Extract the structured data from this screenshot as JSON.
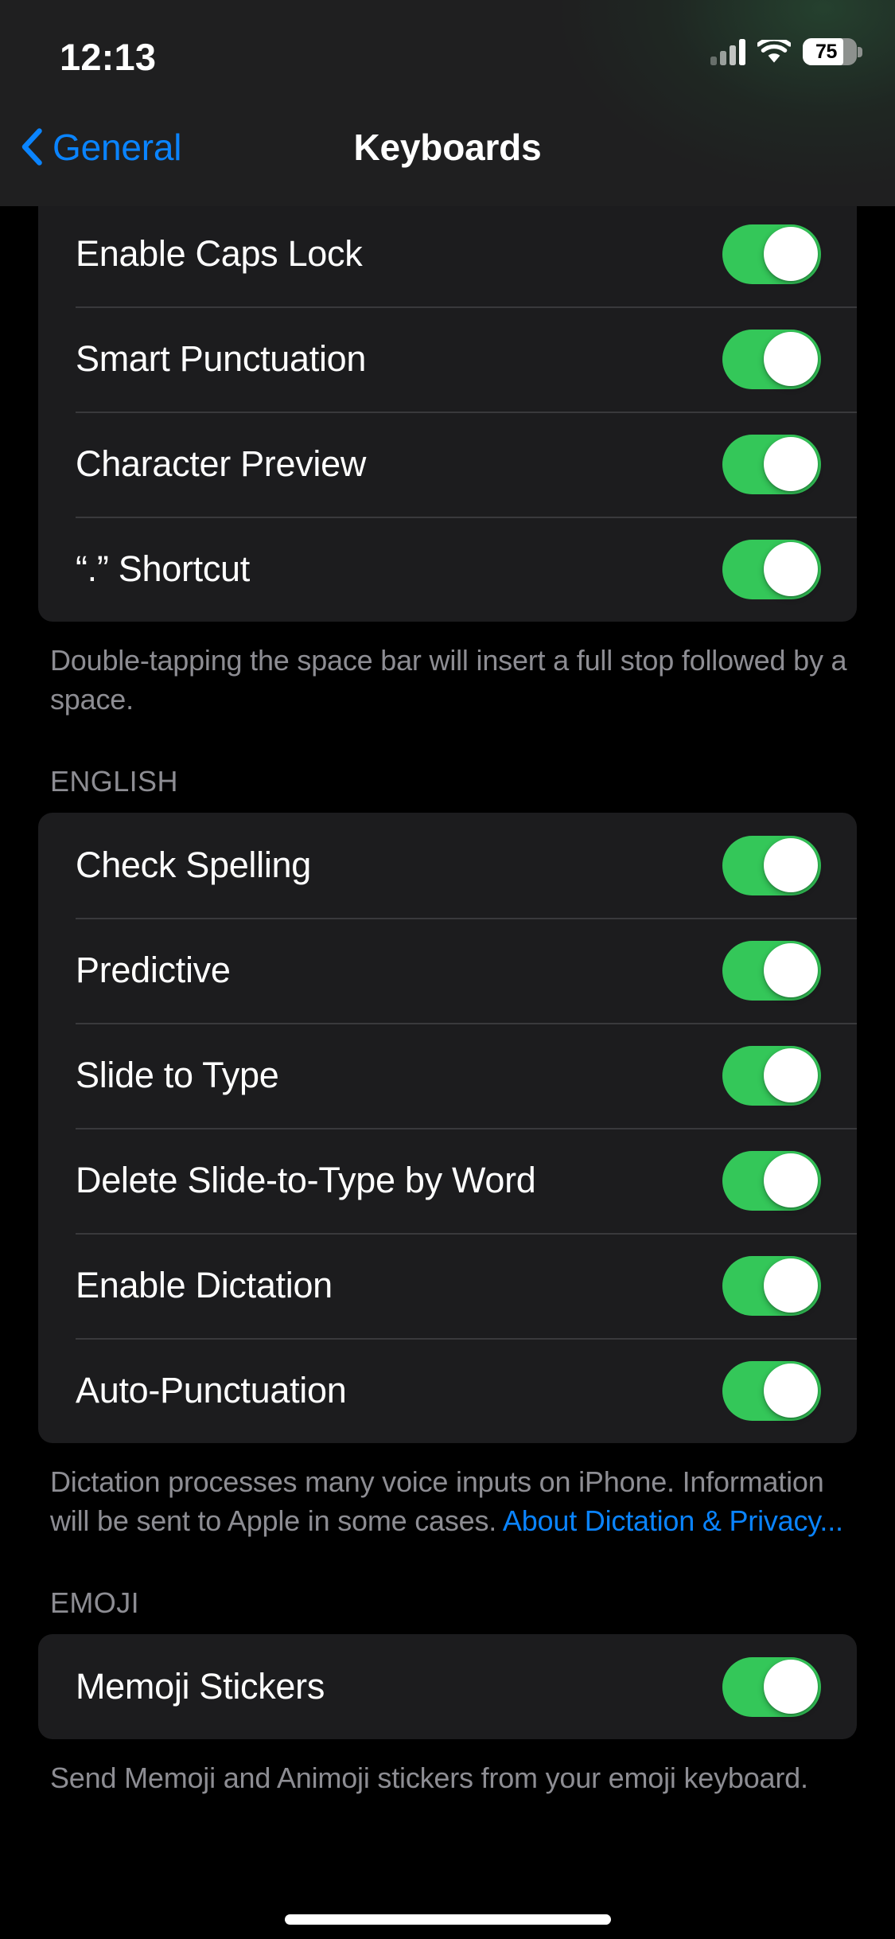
{
  "status_bar": {
    "time": "12:13",
    "battery_percent": "75",
    "battery_level": 75,
    "cellular_bars": 2,
    "icons": [
      "cellular-signal-icon",
      "wifi-icon",
      "battery-icon"
    ]
  },
  "nav": {
    "back_label": "General",
    "title": "Keyboards"
  },
  "sections": [
    {
      "header": "",
      "rows": [
        {
          "label": "Enable Caps Lock",
          "toggle": "on"
        },
        {
          "label": "Smart Punctuation",
          "toggle": "on"
        },
        {
          "label": "Character Preview",
          "toggle": "on"
        },
        {
          "label": "“.” Shortcut",
          "toggle": "on"
        }
      ],
      "footer": "Double-tapping the space bar will insert a full stop followed by a space.",
      "footer_link": ""
    },
    {
      "header": "ENGLISH",
      "rows": [
        {
          "label": "Check Spelling",
          "toggle": "on"
        },
        {
          "label": "Predictive",
          "toggle": "on"
        },
        {
          "label": "Slide to Type",
          "toggle": "on"
        },
        {
          "label": "Delete Slide-to-Type by Word",
          "toggle": "on"
        },
        {
          "label": "Enable Dictation",
          "toggle": "on"
        },
        {
          "label": "Auto-Punctuation",
          "toggle": "on"
        }
      ],
      "footer": "Dictation processes many voice inputs on iPhone. Information will be sent to Apple in some cases. ",
      "footer_link": "About Dictation & Privacy..."
    },
    {
      "header": "EMOJI",
      "rows": [
        {
          "label": "Memoji Stickers",
          "toggle": "on"
        }
      ],
      "footer": "Send Memoji and Animoji stickers from your emoji keyboard.",
      "footer_link": ""
    }
  ],
  "colors": {
    "accent_blue": "#0a84ff",
    "toggle_green": "#34c759",
    "background": "#000000",
    "cell_background": "#1c1c1e",
    "nav_background": "#1f1f20",
    "secondary_text": "#8d8d93"
  }
}
